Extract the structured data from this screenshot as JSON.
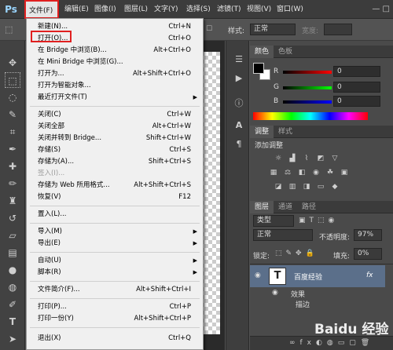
{
  "app": {
    "logo": "Ps",
    "window_controls": "—  □"
  },
  "menubar": {
    "file": "文件(F)",
    "edit": "编辑(E)",
    "image": "图像(I)",
    "layer": "图层(L)",
    "type": "文字(Y)",
    "select": "选择(S)",
    "filter": "滤镜(T)",
    "view": "视图(V)",
    "window": "窗口(W)"
  },
  "options": {
    "style_label": "样式:",
    "style_value": "正常",
    "width_label": "宽度:"
  },
  "file_menu": {
    "items": [
      {
        "label": "新建(N)...",
        "shortcut": "Ctrl+N"
      },
      {
        "label": "打开(O)...",
        "shortcut": "Ctrl+O"
      },
      {
        "label": "在 Bridge 中浏览(B)...",
        "shortcut": "Alt+Ctrl+O"
      },
      {
        "label": "在 Mini Bridge 中浏览(G)...",
        "shortcut": ""
      },
      {
        "label": "打开为...",
        "shortcut": "Alt+Shift+Ctrl+O"
      },
      {
        "label": "打开为智能对象...",
        "shortcut": ""
      },
      {
        "label": "最近打开文件(T)",
        "shortcut": ""
      },
      {
        "label": "关闭(C)",
        "shortcut": "Ctrl+W"
      },
      {
        "label": "关闭全部",
        "shortcut": "Alt+Ctrl+W"
      },
      {
        "label": "关闭并转到 Bridge...",
        "shortcut": "Shift+Ctrl+W"
      },
      {
        "label": "存储(S)",
        "shortcut": "Ctrl+S"
      },
      {
        "label": "存储为(A)...",
        "shortcut": "Shift+Ctrl+S"
      },
      {
        "label": "签入(I)...",
        "shortcut": ""
      },
      {
        "label": "存储为 Web 所用格式...",
        "shortcut": "Alt+Shift+Ctrl+S"
      },
      {
        "label": "恢复(V)",
        "shortcut": "F12"
      },
      {
        "label": "置入(L)...",
        "shortcut": ""
      },
      {
        "label": "导入(M)",
        "shortcut": ""
      },
      {
        "label": "导出(E)",
        "shortcut": ""
      },
      {
        "label": "自动(U)",
        "shortcut": ""
      },
      {
        "label": "脚本(R)",
        "shortcut": ""
      },
      {
        "label": "文件简介(F)...",
        "shortcut": "Alt+Shift+Ctrl+I"
      },
      {
        "label": "打印(P)...",
        "shortcut": "Ctrl+P"
      },
      {
        "label": "打印一份(Y)",
        "shortcut": "Alt+Shift+Ctrl+P"
      },
      {
        "label": "退出(X)",
        "shortcut": "Ctrl+Q"
      }
    ]
  },
  "color_panel": {
    "tabs": [
      "颜色",
      "色板"
    ],
    "r_label": "R",
    "g_label": "G",
    "b_label": "B",
    "r_value": "0",
    "g_value": "0",
    "b_value": "0",
    "colors": {
      "foreground": "#000000",
      "background": "#ffffff"
    }
  },
  "adjust_panel": {
    "tabs": [
      "调整",
      "样式"
    ],
    "title": "添加调整"
  },
  "layers_panel": {
    "tabs": [
      "图层",
      "通道",
      "路径"
    ],
    "kind": "类型",
    "blend_mode": "正常",
    "opacity_label": "不透明度:",
    "opacity_value": "97%",
    "lock_label": "锁定:",
    "fill_label": "填充:",
    "fill_value": "0%",
    "layer": {
      "thumb": "T",
      "name": "百度经验",
      "fx": "fx"
    },
    "effects_label": "效果",
    "stroke_label": "描边"
  },
  "watermark": "Baidu 经验"
}
